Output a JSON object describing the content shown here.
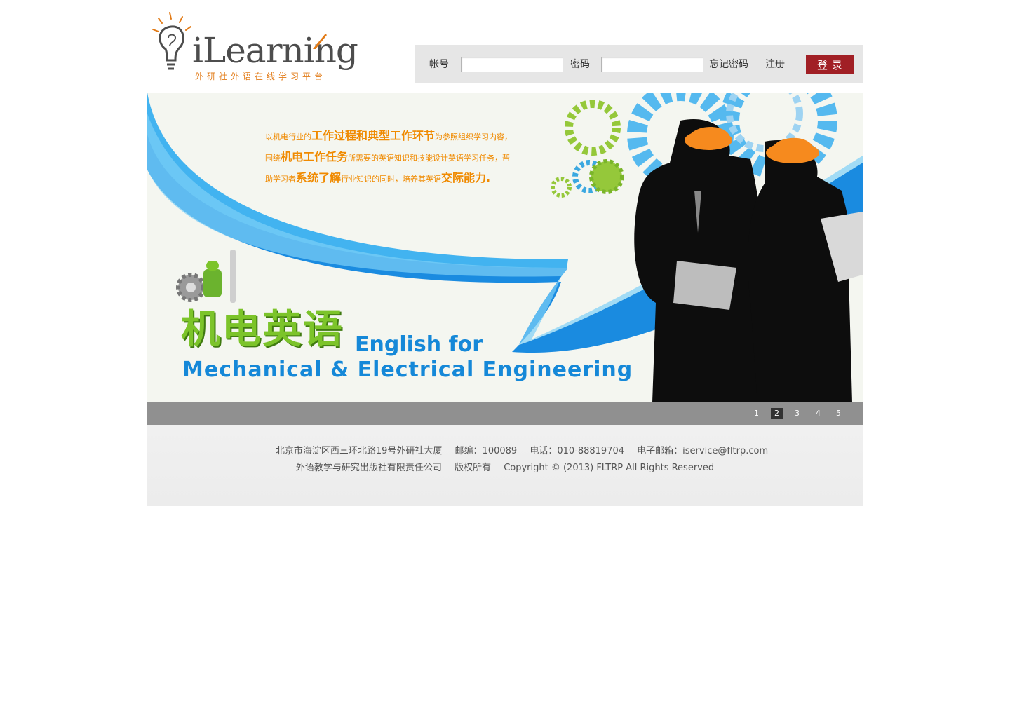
{
  "header": {
    "logo_word": "iLearning",
    "logo_subtitle": "外研社外语在线学习平台"
  },
  "login": {
    "account_label": "帐号",
    "account_value": "",
    "password_label": "密码",
    "password_value": "",
    "forgot_label": "忘记密码",
    "register_label": "注册",
    "submit_label": "登录"
  },
  "banner": {
    "intro_parts": [
      "以机电行业的",
      "工作过程和典型工作环节",
      "为参照组织学习内容，",
      "围绕",
      "机电工作任务",
      "所需要的英语知识和技能设计英语学习任务，帮",
      "助学习者",
      "系统了解",
      "行业知识的同时，培养其英语",
      "交际能力."
    ],
    "title_cn": "机电英语",
    "title_en_line1": "English for",
    "title_en_line2": "Mechanical & Electrical Engineering"
  },
  "pager": {
    "pages": [
      "1",
      "2",
      "3",
      "4",
      "5"
    ],
    "active_page": "2"
  },
  "footer": {
    "address": "北京市海淀区西三环北路19号外研社大厦",
    "postcode_label": "邮编：",
    "postcode": "100089",
    "phone_label": "电话：",
    "phone": "010-88819704",
    "email_label": "电子邮箱：",
    "email": "iservice@fltrp.com",
    "company": "外语教学与研究出版社有限责任公司",
    "rights_label": "版权所有",
    "copyright": "Copyright © (2013) FLTRP All Rights Reserved"
  },
  "colors": {
    "brand_orange": "#e27b17",
    "login_button": "#a11f25",
    "banner_blue": "#1588d8",
    "banner_green": "#7cc42a",
    "pager_bg": "#909090"
  }
}
